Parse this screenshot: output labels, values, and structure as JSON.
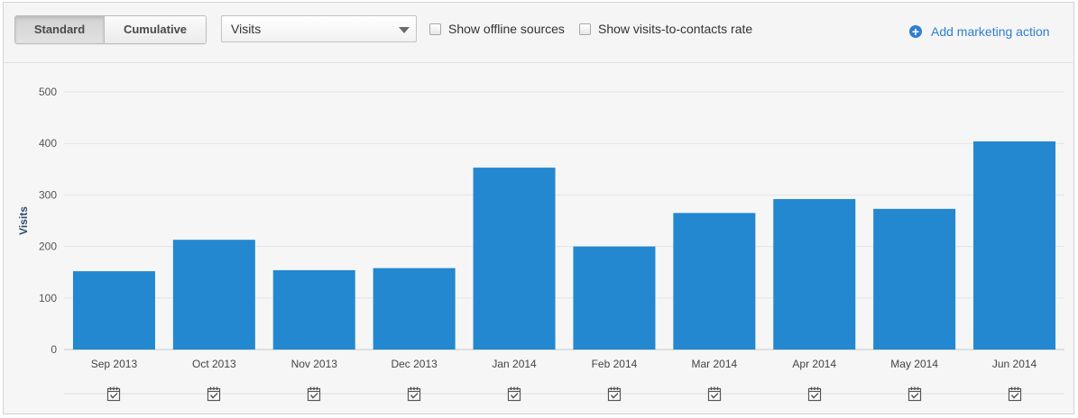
{
  "toolbar": {
    "view_toggle": {
      "standard_label": "Standard",
      "cumulative_label": "Cumulative",
      "selected": "Standard"
    },
    "metric_select": {
      "value": "Visits"
    },
    "offline_sources": {
      "label": "Show offline sources",
      "checked": false
    },
    "visits_rate": {
      "label": "Show visits-to-contacts rate",
      "checked": false
    },
    "add_action": {
      "label": "Add marketing action",
      "icon": "plus-circle-icon"
    }
  },
  "chart_data": {
    "type": "bar",
    "ylabel": "Visits",
    "xlabel": "",
    "title": "",
    "ylim": [
      0,
      500
    ],
    "yticks": [
      0,
      100,
      200,
      300,
      400,
      500
    ],
    "grid": true,
    "categories": [
      "Sep 2013",
      "Oct 2013",
      "Nov 2013",
      "Dec 2013",
      "Jan 2014",
      "Feb 2014",
      "Mar 2014",
      "Apr 2014",
      "May 2014",
      "Jun 2014"
    ],
    "values": [
      152,
      213,
      154,
      158,
      353,
      200,
      265,
      292,
      273,
      404
    ],
    "bar_color": "#2388d0",
    "marker_icon": "calendar-check-icon"
  }
}
